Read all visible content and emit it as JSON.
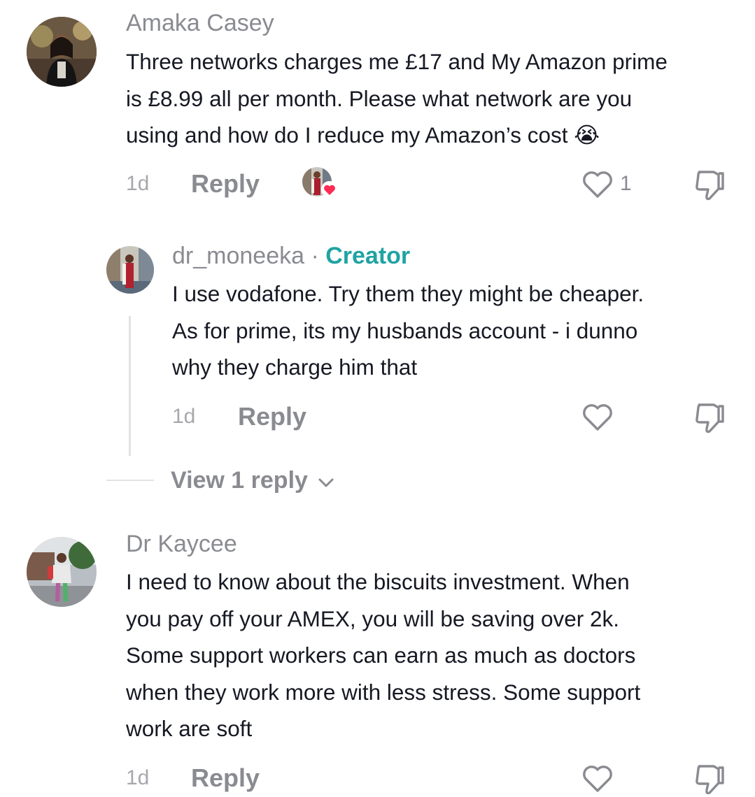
{
  "comments": [
    {
      "username": "Amaka Casey",
      "text_lines": [
        "Three networks charges me £17 and My Amazon prime",
        "is £8.99 all per month. Please what network are you",
        "using and how do I reduce my Amazon’s cost"
      ],
      "emoji": "😭",
      "time": "1d",
      "reply_label": "Reply",
      "like_count": "1"
    },
    {
      "username": "dr_moneeka",
      "separator": " · ",
      "badge": "Creator",
      "text_lines": [
        "I use vodafone. Try them they might be cheaper.",
        "As for prime, its my husbands account - i dunno",
        "why they charge him that"
      ],
      "time": "1d",
      "reply_label": "Reply"
    },
    {
      "username": "Dr Kaycee",
      "text_lines": [
        "I need to know about the biscuits investment. When",
        "you pay off your AMEX, you will be saving over 2k.",
        "Some support workers can earn as much as doctors",
        "when they work more with less stress. Some support",
        "work are soft"
      ],
      "time": "1d",
      "reply_label": "Reply"
    }
  ],
  "view_replies": {
    "label": "View 1 reply"
  },
  "icons": {
    "heart": "heart-outline-icon",
    "dislike": "thumbs-down-icon",
    "chevron": "chevron-down-icon",
    "liked_by_creator": "creator-liked-avatar-icon"
  },
  "colors": {
    "creator_badge": "#20a3a3",
    "heart_badge": "#fe2c55"
  }
}
